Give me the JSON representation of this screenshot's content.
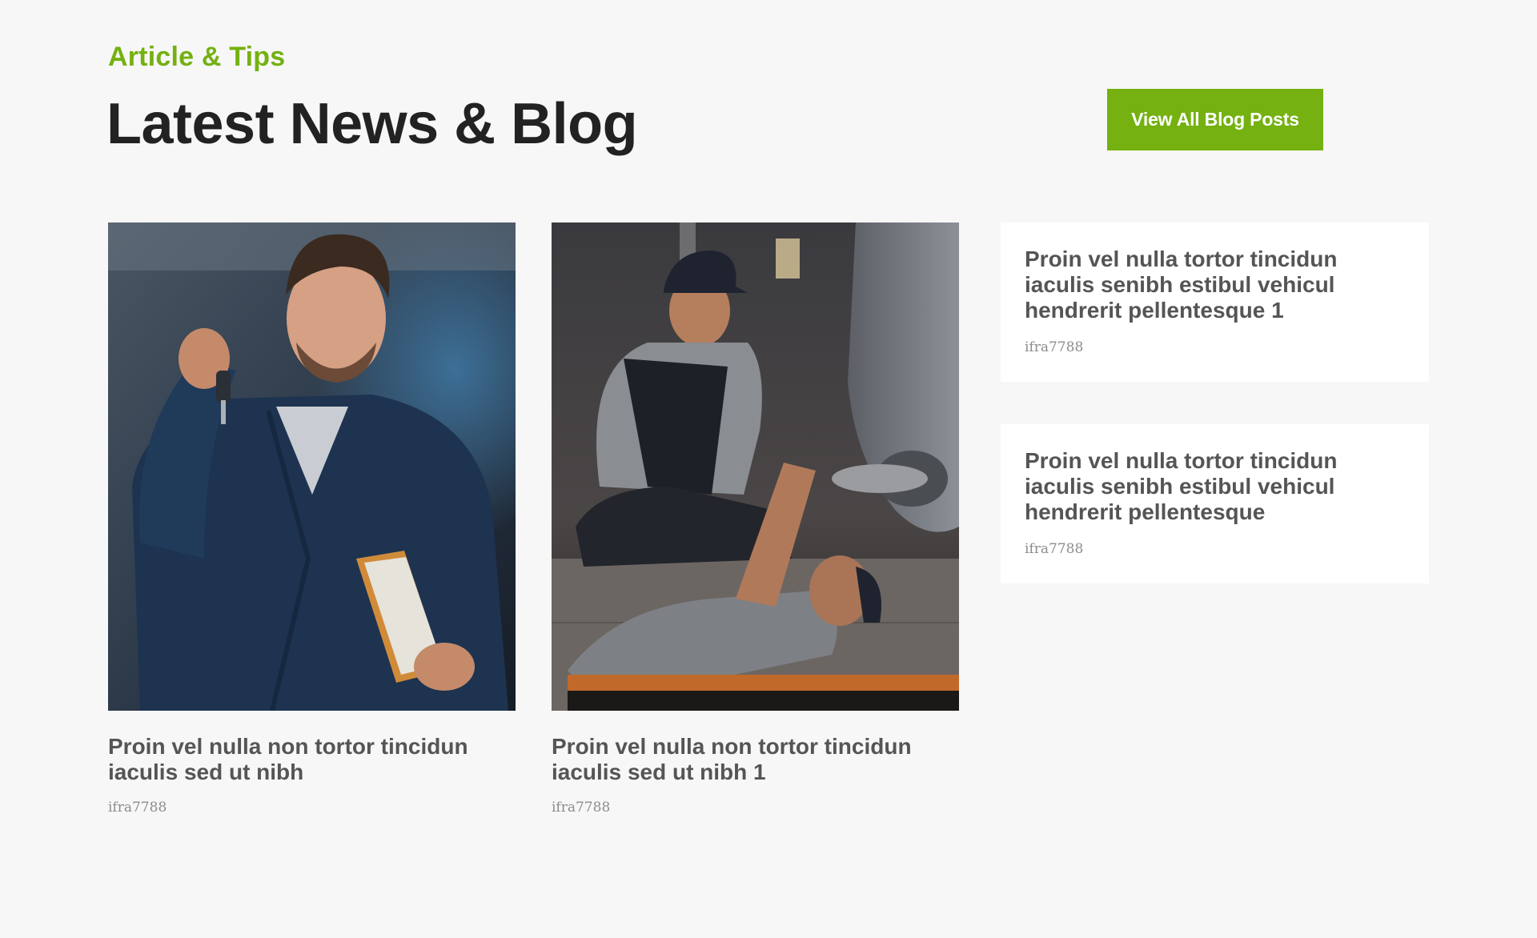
{
  "section": {
    "eyebrow": "Article & Tips",
    "heading": "Latest News & Blog",
    "cta_label": "View All Blog Posts"
  },
  "colors": {
    "accent": "#74b111",
    "heading": "#222222",
    "card_title": "#555555",
    "author": "#8c8c8c",
    "background": "#f7f7f7",
    "card_bg": "#ffffff"
  },
  "featured_posts": [
    {
      "title": "Proin vel nulla non tortor tincidun iaculis sed ut nibh",
      "author": "ifra7788",
      "image": "mechanic-holding-car-keys-photo"
    },
    {
      "title": "Proin vel nulla non tortor tincidun iaculis sed ut nibh 1",
      "author": "ifra7788",
      "image": "mechanics-repairing-car-photo"
    }
  ],
  "side_posts": [
    {
      "title": "Proin vel nulla tortor tincidun iaculis senibh estibul vehicul hendrerit pellentesque 1",
      "author": "ifra7788"
    },
    {
      "title": "Proin vel nulla tortor tincidun iaculis senibh estibul vehicul hendrerit pellentesque",
      "author": "ifra7788"
    }
  ]
}
